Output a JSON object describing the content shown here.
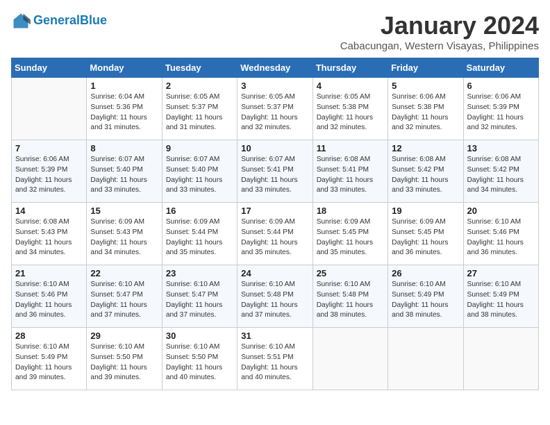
{
  "header": {
    "logo_line1": "General",
    "logo_line2": "Blue",
    "month_title": "January 2024",
    "location": "Cabacungan, Western Visayas, Philippines"
  },
  "days_of_week": [
    "Sunday",
    "Monday",
    "Tuesday",
    "Wednesday",
    "Thursday",
    "Friday",
    "Saturday"
  ],
  "weeks": [
    [
      {
        "day": "",
        "content": ""
      },
      {
        "day": "1",
        "content": "Sunrise: 6:04 AM\nSunset: 5:36 PM\nDaylight: 11 hours\nand 31 minutes."
      },
      {
        "day": "2",
        "content": "Sunrise: 6:05 AM\nSunset: 5:37 PM\nDaylight: 11 hours\nand 31 minutes."
      },
      {
        "day": "3",
        "content": "Sunrise: 6:05 AM\nSunset: 5:37 PM\nDaylight: 11 hours\nand 32 minutes."
      },
      {
        "day": "4",
        "content": "Sunrise: 6:05 AM\nSunset: 5:38 PM\nDaylight: 11 hours\nand 32 minutes."
      },
      {
        "day": "5",
        "content": "Sunrise: 6:06 AM\nSunset: 5:38 PM\nDaylight: 11 hours\nand 32 minutes."
      },
      {
        "day": "6",
        "content": "Sunrise: 6:06 AM\nSunset: 5:39 PM\nDaylight: 11 hours\nand 32 minutes."
      }
    ],
    [
      {
        "day": "7",
        "content": "Sunrise: 6:06 AM\nSunset: 5:39 PM\nDaylight: 11 hours\nand 32 minutes."
      },
      {
        "day": "8",
        "content": "Sunrise: 6:07 AM\nSunset: 5:40 PM\nDaylight: 11 hours\nand 33 minutes."
      },
      {
        "day": "9",
        "content": "Sunrise: 6:07 AM\nSunset: 5:40 PM\nDaylight: 11 hours\nand 33 minutes."
      },
      {
        "day": "10",
        "content": "Sunrise: 6:07 AM\nSunset: 5:41 PM\nDaylight: 11 hours\nand 33 minutes."
      },
      {
        "day": "11",
        "content": "Sunrise: 6:08 AM\nSunset: 5:41 PM\nDaylight: 11 hours\nand 33 minutes."
      },
      {
        "day": "12",
        "content": "Sunrise: 6:08 AM\nSunset: 5:42 PM\nDaylight: 11 hours\nand 33 minutes."
      },
      {
        "day": "13",
        "content": "Sunrise: 6:08 AM\nSunset: 5:42 PM\nDaylight: 11 hours\nand 34 minutes."
      }
    ],
    [
      {
        "day": "14",
        "content": "Sunrise: 6:08 AM\nSunset: 5:43 PM\nDaylight: 11 hours\nand 34 minutes."
      },
      {
        "day": "15",
        "content": "Sunrise: 6:09 AM\nSunset: 5:43 PM\nDaylight: 11 hours\nand 34 minutes."
      },
      {
        "day": "16",
        "content": "Sunrise: 6:09 AM\nSunset: 5:44 PM\nDaylight: 11 hours\nand 35 minutes."
      },
      {
        "day": "17",
        "content": "Sunrise: 6:09 AM\nSunset: 5:44 PM\nDaylight: 11 hours\nand 35 minutes."
      },
      {
        "day": "18",
        "content": "Sunrise: 6:09 AM\nSunset: 5:45 PM\nDaylight: 11 hours\nand 35 minutes."
      },
      {
        "day": "19",
        "content": "Sunrise: 6:09 AM\nSunset: 5:45 PM\nDaylight: 11 hours\nand 36 minutes."
      },
      {
        "day": "20",
        "content": "Sunrise: 6:10 AM\nSunset: 5:46 PM\nDaylight: 11 hours\nand 36 minutes."
      }
    ],
    [
      {
        "day": "21",
        "content": "Sunrise: 6:10 AM\nSunset: 5:46 PM\nDaylight: 11 hours\nand 36 minutes."
      },
      {
        "day": "22",
        "content": "Sunrise: 6:10 AM\nSunset: 5:47 PM\nDaylight: 11 hours\nand 37 minutes."
      },
      {
        "day": "23",
        "content": "Sunrise: 6:10 AM\nSunset: 5:47 PM\nDaylight: 11 hours\nand 37 minutes."
      },
      {
        "day": "24",
        "content": "Sunrise: 6:10 AM\nSunset: 5:48 PM\nDaylight: 11 hours\nand 37 minutes."
      },
      {
        "day": "25",
        "content": "Sunrise: 6:10 AM\nSunset: 5:48 PM\nDaylight: 11 hours\nand 38 minutes."
      },
      {
        "day": "26",
        "content": "Sunrise: 6:10 AM\nSunset: 5:49 PM\nDaylight: 11 hours\nand 38 minutes."
      },
      {
        "day": "27",
        "content": "Sunrise: 6:10 AM\nSunset: 5:49 PM\nDaylight: 11 hours\nand 38 minutes."
      }
    ],
    [
      {
        "day": "28",
        "content": "Sunrise: 6:10 AM\nSunset: 5:49 PM\nDaylight: 11 hours\nand 39 minutes."
      },
      {
        "day": "29",
        "content": "Sunrise: 6:10 AM\nSunset: 5:50 PM\nDaylight: 11 hours\nand 39 minutes."
      },
      {
        "day": "30",
        "content": "Sunrise: 6:10 AM\nSunset: 5:50 PM\nDaylight: 11 hours\nand 40 minutes."
      },
      {
        "day": "31",
        "content": "Sunrise: 6:10 AM\nSunset: 5:51 PM\nDaylight: 11 hours\nand 40 minutes."
      },
      {
        "day": "",
        "content": ""
      },
      {
        "day": "",
        "content": ""
      },
      {
        "day": "",
        "content": ""
      }
    ]
  ]
}
